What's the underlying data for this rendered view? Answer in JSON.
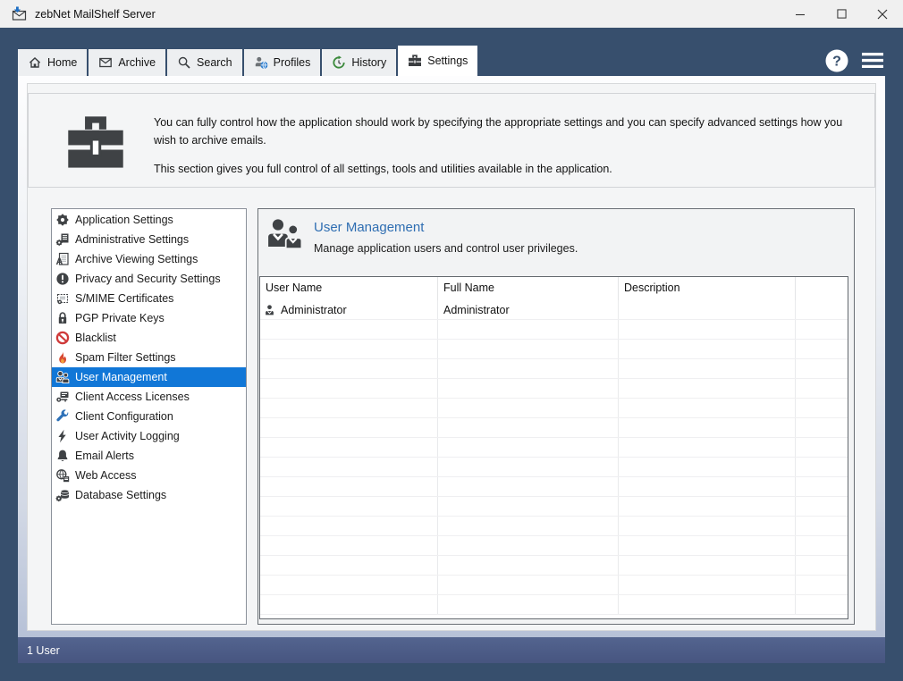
{
  "window": {
    "title": "zebNet MailShelf Server",
    "app_icon": "mail-download",
    "controls": [
      {
        "name": "minimize",
        "icon": "minimize"
      },
      {
        "name": "maximize",
        "icon": "maximize"
      },
      {
        "name": "close",
        "icon": "close"
      }
    ]
  },
  "tabs": [
    {
      "label": "Home",
      "icon": "home",
      "active": false
    },
    {
      "label": "Archive",
      "icon": "archive",
      "active": false
    },
    {
      "label": "Search",
      "icon": "search",
      "active": false
    },
    {
      "label": "Profiles",
      "icon": "profiles",
      "active": false
    },
    {
      "label": "History",
      "icon": "history",
      "active": false
    },
    {
      "label": "Settings",
      "icon": "settings-toolbox",
      "active": true
    }
  ],
  "header_actions": {
    "help_icon": "help",
    "menu_icon": "menu"
  },
  "intro": {
    "icon": "toolbox",
    "paragraph1": "You can fully control how the application should work by specifying the appropriate settings and you can specify advanced settings how you wish to archive emails.",
    "paragraph2": "This section gives you full control of all settings, tools and utilities available in the application."
  },
  "sidebar": {
    "items": [
      {
        "label": "Application Settings",
        "icon": "gear",
        "selected": false
      },
      {
        "label": "Administrative Settings",
        "icon": "gear-doc",
        "selected": false
      },
      {
        "label": "Archive Viewing Settings",
        "icon": "doc-a",
        "selected": false
      },
      {
        "label": "Privacy and Security Settings",
        "icon": "alert-circle",
        "selected": false
      },
      {
        "label": "S/MIME Certificates",
        "icon": "certificate",
        "selected": false
      },
      {
        "label": "PGP Private Keys",
        "icon": "padlock",
        "selected": false
      },
      {
        "label": "Blacklist",
        "icon": "prohibition",
        "selected": false
      },
      {
        "label": "Spam Filter Settings",
        "icon": "flame",
        "selected": false
      },
      {
        "label": "User Management",
        "icon": "users",
        "selected": true
      },
      {
        "label": "Client Access Licenses",
        "icon": "key-card",
        "selected": false
      },
      {
        "label": "Client Configuration",
        "icon": "wrench",
        "selected": false
      },
      {
        "label": "User Activity Logging",
        "icon": "lightning",
        "selected": false
      },
      {
        "label": "Email Alerts",
        "icon": "bell",
        "selected": false
      },
      {
        "label": "Web Access",
        "icon": "globe-doc",
        "selected": false
      },
      {
        "label": "Database Settings",
        "icon": "gear-database",
        "selected": false
      }
    ]
  },
  "content": {
    "title": "User Management",
    "subtitle": "Manage application users and control user privileges.",
    "icon": "users-large",
    "table": {
      "columns": [
        "User Name",
        "Full Name",
        "Description",
        ""
      ],
      "rows": [
        {
          "icon": "person",
          "user_name": "Administrator",
          "full_name": "Administrator",
          "description": ""
        }
      ],
      "empty_rows": 15
    }
  },
  "status_bar": {
    "text": "1 User"
  },
  "colors": {
    "frame_blue": "#374f6d",
    "selection_blue": "#1177d7",
    "section_title_blue": "#2f6eb2",
    "status_bar_blue": "#4c5d88",
    "blacklist_red": "#cf3a3a",
    "flame_red": "#d84a32",
    "wrench_blue": "#2e71b8",
    "history_green": "#3c8a3c"
  }
}
